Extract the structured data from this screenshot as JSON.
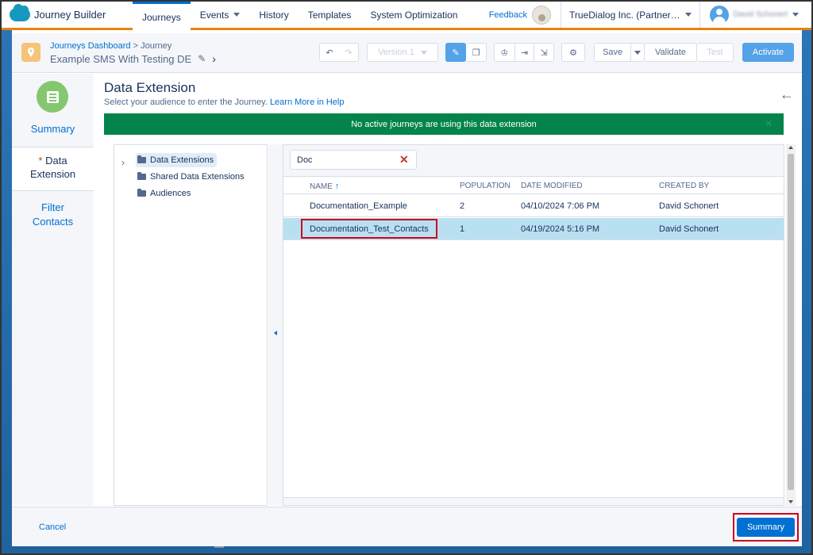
{
  "app": {
    "title": "Journey Builder",
    "nav_tabs": [
      {
        "label": "Journeys",
        "active": true,
        "has_caret": false
      },
      {
        "label": "Events",
        "active": false,
        "has_caret": true
      },
      {
        "label": "History",
        "active": false,
        "has_caret": false
      },
      {
        "label": "Templates",
        "active": false,
        "has_caret": false
      },
      {
        "label": "System Optimization",
        "active": false,
        "has_caret": false
      }
    ],
    "feedback": "Feedback",
    "org_name": "TrueDialog Inc. (Partner…",
    "user_name": "David Schonert"
  },
  "journey": {
    "breadcrumb_link": "Journeys Dashboard",
    "breadcrumb_sep": ">",
    "breadcrumb_current": "Journey",
    "name": "Example SMS With Testing DE",
    "version": "Version 1",
    "save": "Save",
    "validate": "Validate",
    "test": "Test",
    "activate": "Activate",
    "undo_icon": "undo-icon",
    "redo_icon": "redo-icon"
  },
  "steps": {
    "summary": "Summary",
    "data_extension_required": "*",
    "data_extension_line1": "Data",
    "data_extension_line2": "Extension",
    "filter_line1": "Filter",
    "filter_line2": "Contacts"
  },
  "panel": {
    "title": "Data Extension",
    "subtitle": "Select your audience to enter the Journey.",
    "help_link": "Learn More in Help",
    "banner": "No active journeys are using this data extension",
    "tree": [
      {
        "label": "Data Extensions",
        "selected": true
      },
      {
        "label": "Shared Data Extensions",
        "selected": false
      },
      {
        "label": "Audiences",
        "selected": false
      }
    ],
    "search_value": "Doc",
    "columns": {
      "name": "NAME",
      "population": "POPULATION",
      "date_modified": "DATE MODIFIED",
      "created_by": "CREATED BY"
    },
    "rows": [
      {
        "name": "Documentation_Example",
        "population": "2",
        "date_modified": "04/10/2024 7:06 PM",
        "created_by": "David Schonert",
        "selected": false
      },
      {
        "name": "Documentation_Test_Contacts",
        "population": "1",
        "date_modified": "04/19/2024 5:16 PM",
        "created_by": "David Schonert",
        "selected": true
      }
    ]
  },
  "footer": {
    "cancel": "Cancel",
    "summary_button": "Summary"
  },
  "colors": {
    "accent": "#0070d2",
    "nav_underline": "#e8820e",
    "banner": "#04844b",
    "selected_row": "#b9e0f1",
    "highlight": "#d0021b",
    "summary_icon": "#84c76e"
  }
}
